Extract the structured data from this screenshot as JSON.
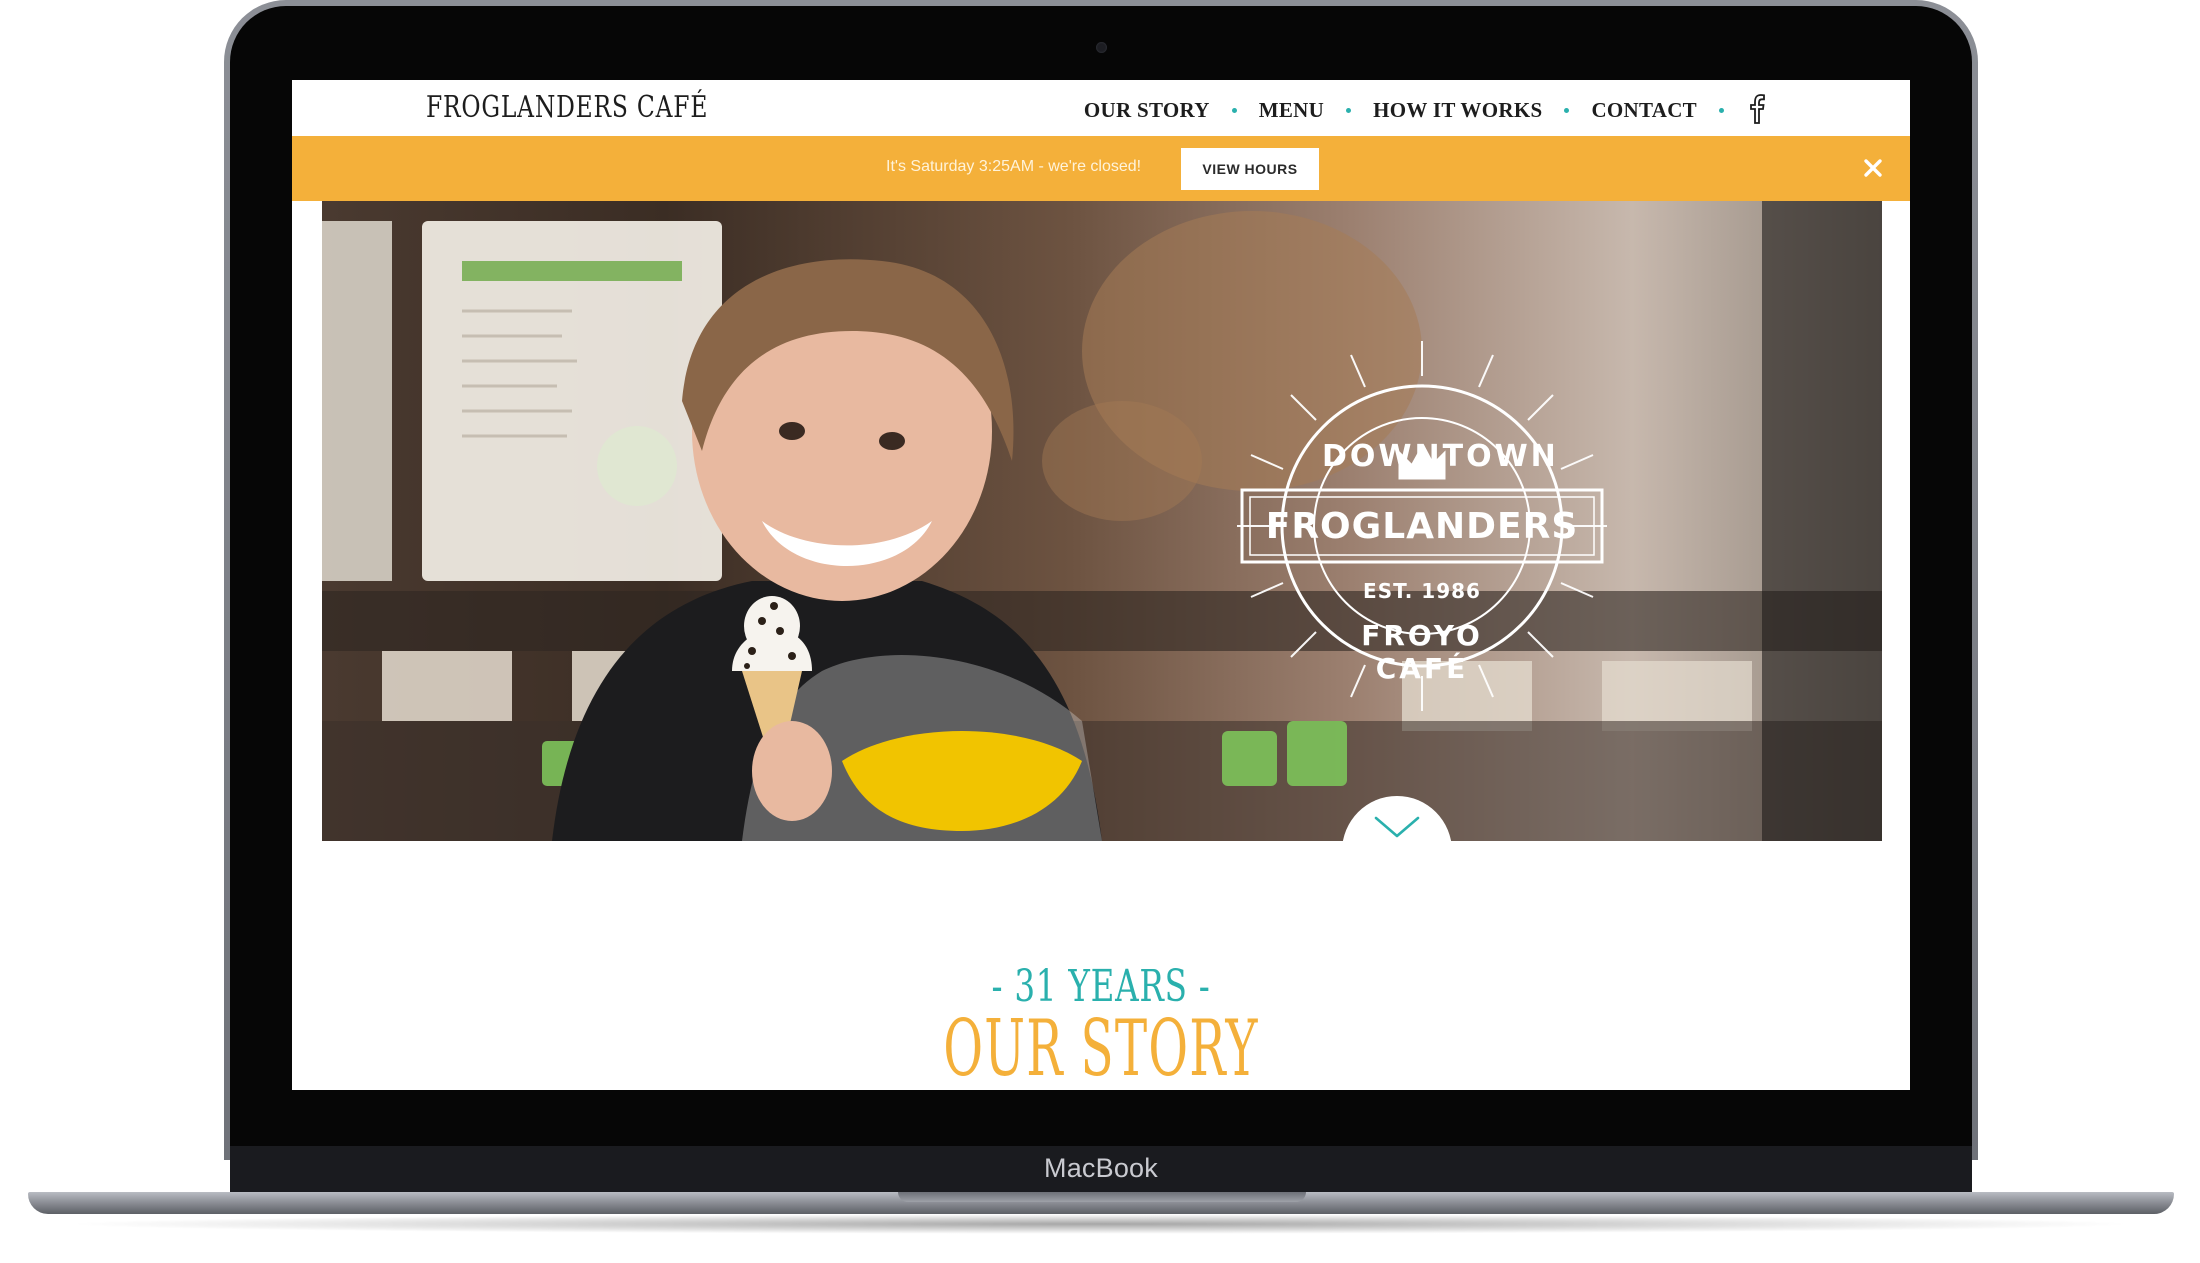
{
  "device": {
    "brand_label": "MacBook"
  },
  "nav": {
    "logo": "FROGLANDERS CAFÉ",
    "links": [
      {
        "label": "OUR STORY"
      },
      {
        "label": "MENU"
      },
      {
        "label": "HOW IT WORKS"
      },
      {
        "label": "CONTACT"
      }
    ],
    "social_icon": "facebook-icon"
  },
  "notice": {
    "message": "It's Saturday 3:25AM - we're closed!",
    "button_label": "VIEW HOURS",
    "close_icon": "close-icon"
  },
  "hero": {
    "badge": {
      "top_arc": "DOWNTOWN",
      "name": "FROGLANDERS",
      "established": "EST. 1986",
      "bottom_arc": "FROYO CAFÉ"
    },
    "scroll_icon": "chevron-down-icon"
  },
  "story": {
    "kicker": "- 31 YEARS -",
    "title": "OUR STORY"
  },
  "colors": {
    "accent_teal": "#2ab0ad",
    "accent_orange": "#f4b03a",
    "banner": "#f4b03a",
    "text_dark": "#1d1d1d"
  }
}
